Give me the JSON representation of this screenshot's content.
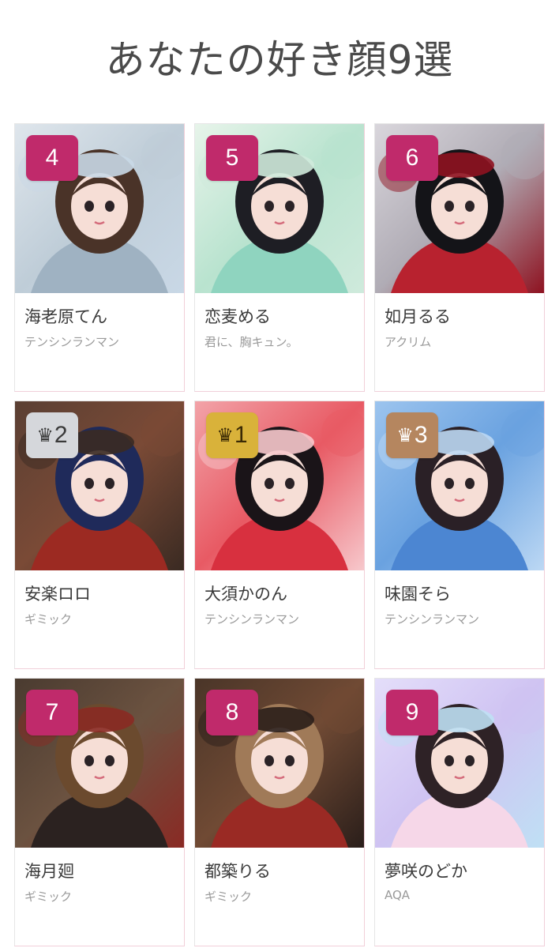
{
  "title": "あなたの好き顔9選",
  "cards": [
    {
      "rank": "4",
      "crown": "",
      "badge_color": "#c02a6b",
      "badge_style": "pink",
      "name": "海老原てん",
      "group": "テンシンランマン",
      "photo_colors": [
        "#dfe6ec",
        "#bfcdd8",
        "#9fb2c2",
        "#c9d8e6"
      ],
      "hair": "#4a3328"
    },
    {
      "rank": "5",
      "crown": "",
      "badge_color": "#c02a6b",
      "badge_style": "pink",
      "name": "恋麦める",
      "group": "君に、胸キュン。",
      "photo_colors": [
        "#e7f4ea",
        "#b9e3cf",
        "#8fd4bf",
        "#cfeadc"
      ],
      "hair": "#1e1e24"
    },
    {
      "rank": "6",
      "crown": "",
      "badge_color": "#c02a6b",
      "badge_style": "pink",
      "name": "如月るる",
      "group": "アクリム",
      "photo_colors": [
        "#d9d6dc",
        "#b0acb5",
        "#b8222f",
        "#8e1220"
      ],
      "hair": "#141418"
    },
    {
      "rank": "2",
      "crown": "♛",
      "badge_color": "#d5d7db",
      "badge_style": "silver",
      "name": "安楽ロロ",
      "group": "ギミック",
      "photo_colors": [
        "#5a3f33",
        "#7a4a36",
        "#9c2a22",
        "#3a2a22"
      ],
      "hair": "#1f2a5a"
    },
    {
      "rank": "1",
      "crown": "♛",
      "badge_color": "#d9b23a",
      "badge_style": "gold",
      "name": "大須かのん",
      "group": "テンシンランマン",
      "photo_colors": [
        "#f2a3a8",
        "#e85a64",
        "#d8303f",
        "#f7c8cc"
      ],
      "hair": "#1a1418"
    },
    {
      "rank": "3",
      "crown": "♛",
      "badge_color": "#b5865f",
      "badge_style": "bronze",
      "name": "味園そら",
      "group": "テンシンランマン",
      "photo_colors": [
        "#9cc4ee",
        "#6aa2e0",
        "#4c86d2",
        "#bcd8f4"
      ],
      "hair": "#2a2026"
    },
    {
      "rank": "7",
      "crown": "",
      "badge_color": "#c02a6b",
      "badge_style": "pink",
      "name": "海月廻",
      "group": "ギミック",
      "photo_colors": [
        "#4a3b30",
        "#6b5240",
        "#2b2220",
        "#8a2a24"
      ],
      "hair": "#6b4a2e"
    },
    {
      "rank": "8",
      "crown": "",
      "badge_color": "#c02a6b",
      "badge_style": "pink",
      "name": "都築りる",
      "group": "ギミック",
      "photo_colors": [
        "#4a3528",
        "#704a34",
        "#9a2a24",
        "#2a1e1a"
      ],
      "hair": "#a07a58"
    },
    {
      "rank": "9",
      "crown": "",
      "badge_color": "#c02a6b",
      "badge_style": "pink",
      "name": "夢咲のどか",
      "group": "AQA",
      "photo_colors": [
        "#e4defa",
        "#cfc3f2",
        "#f6d7e8",
        "#bfe0f4"
      ],
      "hair": "#2e2226"
    }
  ]
}
